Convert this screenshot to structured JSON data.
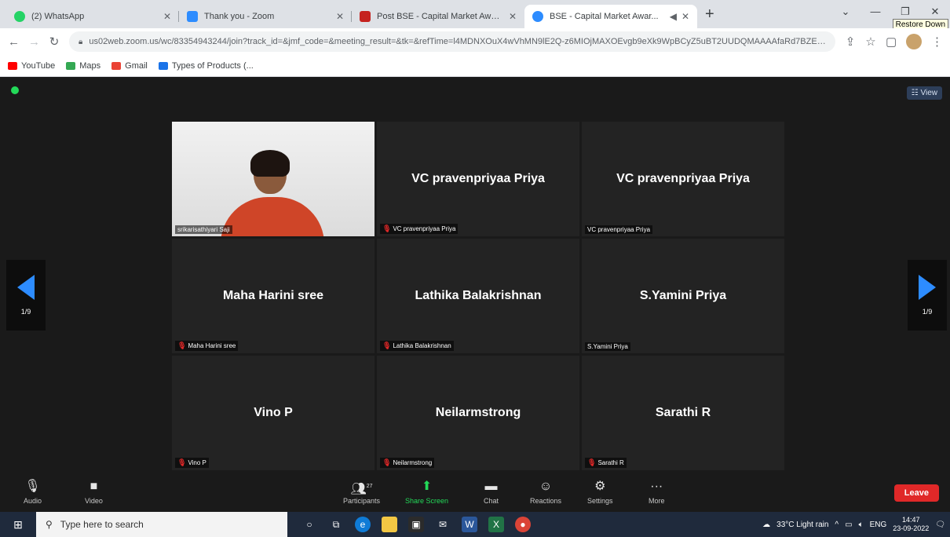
{
  "browser": {
    "tabs": [
      {
        "title": "(2) WhatsApp",
        "color": "#25d366"
      },
      {
        "title": "Thank you - Zoom",
        "color": "#2d8cff"
      },
      {
        "title": "Post BSE - Capital Market Awar...",
        "color": "#c5221f"
      },
      {
        "title": "BSE - Capital Market Awar...",
        "color": "#2d8cff"
      }
    ],
    "restore_tooltip": "Restore Down",
    "url": "us02web.zoom.us/wc/83354943244/join?track_id=&jmf_code=&meeting_result=&tk=&refTime=l4MDNXOuX4wVhMN9lE2Q-z6MIOjMAXOEvgb9eXk9WpBCyZ5uBT2UUDQMAAAAfaRd7BZEMoRZd...",
    "bookmarks": [
      {
        "label": "YouTube",
        "color": "#ff0000"
      },
      {
        "label": "Maps",
        "color": "#34a853"
      },
      {
        "label": "Gmail",
        "color": "#ea4335"
      },
      {
        "label": "Types of Products (...",
        "color": "#1a73e8"
      }
    ]
  },
  "zoom": {
    "view_label": "View",
    "pager": {
      "left": "1/9",
      "right": "1/9"
    },
    "tiles": [
      {
        "name": "srikarisathiyari Saji",
        "big": "",
        "video": true,
        "muted": false
      },
      {
        "name": "VC pravenpriyaa Priya",
        "big": "VC pravenpriyaa Priya",
        "video": false,
        "muted": true
      },
      {
        "name": "VC pravenpriyaa Priya",
        "big": "VC pravenpriyaa Priya",
        "video": false,
        "muted": false
      },
      {
        "name": "Maha Harini sree",
        "big": "Maha Harini sree",
        "video": false,
        "muted": true
      },
      {
        "name": "Lathika Balakrishnan",
        "big": "Lathika Balakrishnan",
        "video": false,
        "muted": true
      },
      {
        "name": "S.Yamini Priya",
        "big": "S.Yamini Priya",
        "video": false,
        "muted": false
      },
      {
        "name": "Vino P",
        "big": "Vino P",
        "video": false,
        "muted": true
      },
      {
        "name": "Neilarmstrong",
        "big": "Neilarmstrong",
        "video": false,
        "muted": true
      },
      {
        "name": "Sarathi R",
        "big": "Sarathi R",
        "video": false,
        "muted": true
      }
    ],
    "toolbar": {
      "audio": "Audio",
      "video": "Video",
      "participants": "Participants",
      "participants_count": "27",
      "share": "Share Screen",
      "chat": "Chat",
      "reactions": "Reactions",
      "settings": "Settings",
      "more": "More",
      "leave": "Leave"
    }
  },
  "taskbar": {
    "search_placeholder": "Type here to search",
    "weather": "33°C  Light rain",
    "lang": "ENG",
    "time": "14:47",
    "date": "23-09-2022"
  }
}
